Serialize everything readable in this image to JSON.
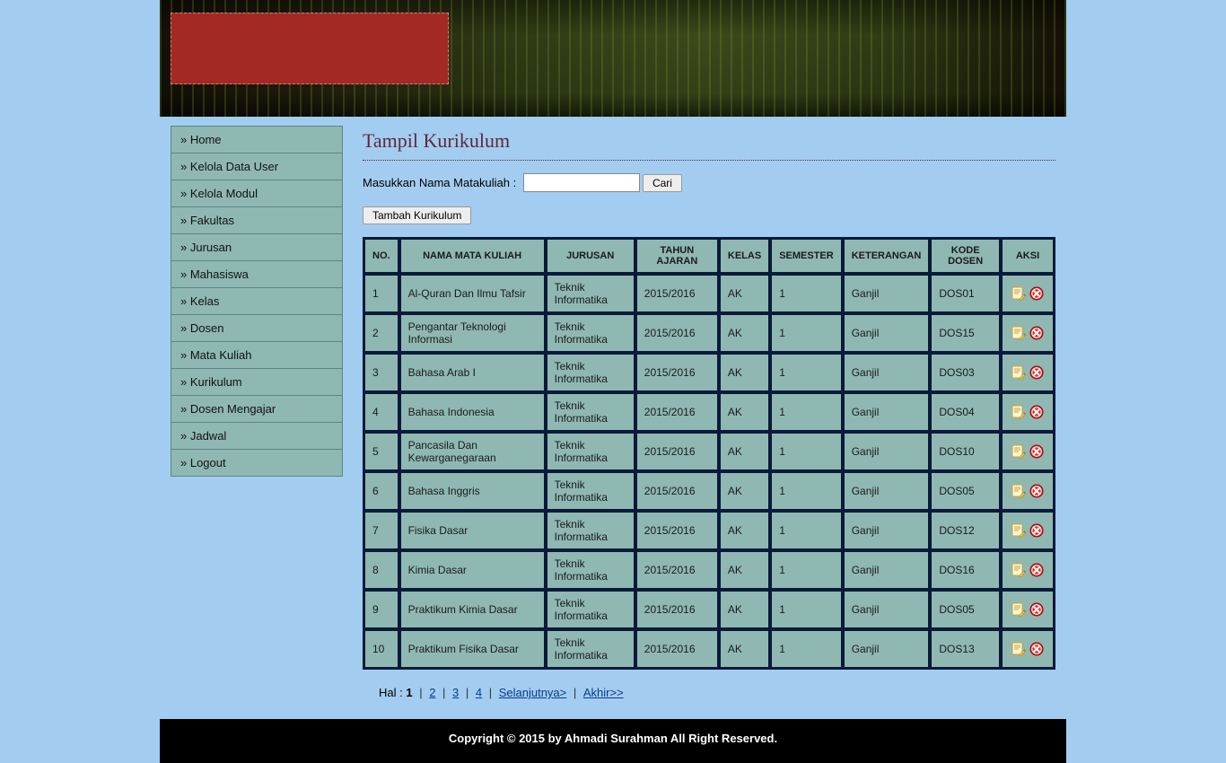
{
  "sidebar": {
    "items": [
      {
        "label": "Home"
      },
      {
        "label": "Kelola Data User"
      },
      {
        "label": "Kelola Modul"
      },
      {
        "label": "Fakultas"
      },
      {
        "label": "Jurusan"
      },
      {
        "label": "Mahasiswa"
      },
      {
        "label": "Kelas"
      },
      {
        "label": "Dosen"
      },
      {
        "label": "Mata Kuliah"
      },
      {
        "label": "Kurikulum"
      },
      {
        "label": "Dosen Mengajar"
      },
      {
        "label": "Jadwal"
      },
      {
        "label": "Logout"
      }
    ],
    "prefix": "» "
  },
  "page": {
    "title": "Tampil Kurikulum",
    "search_label": "Masukkan Nama Matakuliah :",
    "search_button": "Cari",
    "add_button": "Tambah Kurikulum"
  },
  "table": {
    "headers": [
      "NO.",
      "NAMA MATA KULIAH",
      "JURUSAN",
      "TAHUN AJARAN",
      "KELAS",
      "SEMESTER",
      "KETERANGAN",
      "KODE DOSEN",
      "AKSI"
    ],
    "rows": [
      {
        "no": "1",
        "nama": "Al-Quran Dan Ilmu Tafsir",
        "jurusan": "Teknik Informatika",
        "tahun": "2015/2016",
        "kelas": "AK",
        "semester": "1",
        "ket": "Ganjil",
        "kode": "DOS01"
      },
      {
        "no": "2",
        "nama": "Pengantar Teknologi Informasi",
        "jurusan": "Teknik Informatika",
        "tahun": "2015/2016",
        "kelas": "AK",
        "semester": "1",
        "ket": "Ganjil",
        "kode": "DOS15"
      },
      {
        "no": "3",
        "nama": "Bahasa Arab I",
        "jurusan": "Teknik Informatika",
        "tahun": "2015/2016",
        "kelas": "AK",
        "semester": "1",
        "ket": "Ganjil",
        "kode": "DOS03"
      },
      {
        "no": "4",
        "nama": "Bahasa Indonesia",
        "jurusan": "Teknik Informatika",
        "tahun": "2015/2016",
        "kelas": "AK",
        "semester": "1",
        "ket": "Ganjil",
        "kode": "DOS04"
      },
      {
        "no": "5",
        "nama": "Pancasila Dan Kewarganegaraan",
        "jurusan": "Teknik Informatika",
        "tahun": "2015/2016",
        "kelas": "AK",
        "semester": "1",
        "ket": "Ganjil",
        "kode": "DOS10"
      },
      {
        "no": "6",
        "nama": "Bahasa Inggris",
        "jurusan": "Teknik Informatika",
        "tahun": "2015/2016",
        "kelas": "AK",
        "semester": "1",
        "ket": "Ganjil",
        "kode": "DOS05"
      },
      {
        "no": "7",
        "nama": "Fisika Dasar",
        "jurusan": "Teknik Informatika",
        "tahun": "2015/2016",
        "kelas": "AK",
        "semester": "1",
        "ket": "Ganjil",
        "kode": "DOS12"
      },
      {
        "no": "8",
        "nama": "Kimia Dasar",
        "jurusan": "Teknik Informatika",
        "tahun": "2015/2016",
        "kelas": "AK",
        "semester": "1",
        "ket": "Ganjil",
        "kode": "DOS16"
      },
      {
        "no": "9",
        "nama": "Praktikum Kimia Dasar",
        "jurusan": "Teknik Informatika",
        "tahun": "2015/2016",
        "kelas": "AK",
        "semester": "1",
        "ket": "Ganjil",
        "kode": "DOS05"
      },
      {
        "no": "10",
        "nama": "Praktikum Fisika Dasar",
        "jurusan": "Teknik Informatika",
        "tahun": "2015/2016",
        "kelas": "AK",
        "semester": "1",
        "ket": "Ganjil",
        "kode": "DOS13"
      }
    ]
  },
  "pager": {
    "prefix": "Hal : ",
    "current": "1",
    "pages": [
      "2",
      "3",
      "4"
    ],
    "next": "Selanjutnya>",
    "last": "Akhir>>"
  },
  "footer": "Copyright © 2015 by Ahmadi Surahman All Right Reserved."
}
